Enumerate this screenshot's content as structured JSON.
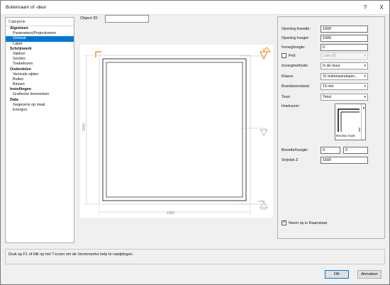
{
  "window": {
    "title": "Buitenraam of -deur",
    "help_symbol": "?",
    "close_symbol": "X"
  },
  "sidebar": {
    "header": "Categorie",
    "items": [
      {
        "label": "Algemeen",
        "group": true
      },
      {
        "label": "Parameters/Projectramen",
        "group": false
      },
      {
        "label": "Globaal",
        "group": false,
        "selected": true
      },
      {
        "label": "Label",
        "group": false
      },
      {
        "label": "Schrijnwerk",
        "group": true
      },
      {
        "label": "Vakken",
        "group": false
      },
      {
        "label": "Secties",
        "group": false
      },
      {
        "label": "Toebehoren",
        "group": false
      },
      {
        "label": "Onderdelen",
        "group": true
      },
      {
        "label": "Verticale zijden",
        "group": false
      },
      {
        "label": "Buiten",
        "group": false
      },
      {
        "label": "Binnen",
        "group": false
      },
      {
        "label": "Instellingen",
        "group": true
      },
      {
        "label": "Grafische kenmerken",
        "group": false
      },
      {
        "label": "Data",
        "group": true
      },
      {
        "label": "Gegevens op maat",
        "group": false
      },
      {
        "label": "Energos",
        "group": false
      }
    ]
  },
  "object_id": {
    "label": "Object ID:",
    "value": ""
  },
  "preview": {
    "width_dim": "1000",
    "height_dim": "1000",
    "level_top": "0",
    "level_bottom": "-1000"
  },
  "props": {
    "opening_breedte": {
      "label": "Opening breedte:",
      "value": "1000"
    },
    "opening_hoogte": {
      "label": "Opening hoogte:",
      "value": "1000"
    },
    "invoeghoogte": {
      "label": "Invoeghoogte:",
      "value": "0"
    },
    "peil": {
      "label": "Peil:",
      "value": "Latei (0)",
      "checked": false
    },
    "invoegmethode": {
      "label": "Invoegmethode:",
      "value": "In de muur"
    },
    "klasse": {
      "label": "Klasse:",
      "value": "31 buitenwandopen..."
    },
    "brandweerstand": {
      "label": "Brandweerstand:",
      "value": "15 min"
    },
    "toon": {
      "label": "Toon:",
      "value": "Tekst"
    },
    "hoekvorm": {
      "label": "Hoekvorm:",
      "value": "Rechte hoek"
    },
    "breedte_hoogte": {
      "label": "Breedte/hoogte:",
      "value1": "0",
      "value2": "0"
    },
    "snijvlak": {
      "label": "Snijvlak Z:",
      "value": "1500"
    },
    "neem_op": {
      "label": "Neem op in Raamstaat",
      "checked": true
    }
  },
  "status": {
    "text": "Druk op F1 of klik op het ?-icoon om de Vectorworks help te raadplegen."
  },
  "buttons": {
    "ok": "OK",
    "cancel": "Annuleer"
  },
  "colors": {
    "accent": "#0078d7",
    "marker": "#f7941d"
  }
}
